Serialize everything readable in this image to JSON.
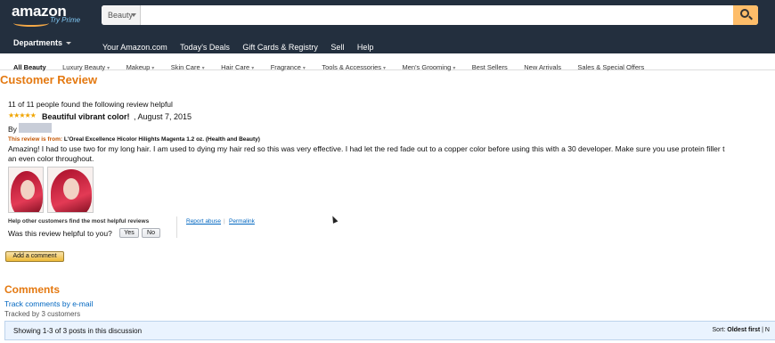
{
  "header": {
    "logo_text": "amazon",
    "logo_sub": "Try Prime",
    "search_category": "Beauty",
    "search_placeholder": ""
  },
  "nav": {
    "departments": "Departments",
    "links": [
      "Your Amazon.com",
      "Today's Deals",
      "Gift Cards & Registry",
      "Sell",
      "Help"
    ]
  },
  "subnav": {
    "items": [
      "All Beauty",
      "Luxury Beauty",
      "Makeup",
      "Skin Care",
      "Hair Care",
      "Fragrance",
      "Tools & Accessories",
      "Men's Grooming",
      "Best Sellers",
      "New Arrivals",
      "Sales & Special Offers"
    ]
  },
  "review": {
    "heading": "Customer Review",
    "helpful_count": "11 of 11 people found the following review helpful",
    "stars": "★★★★★",
    "title": "Beautiful vibrant color!",
    "date": ", August 7, 2015",
    "by": "By",
    "from_label": "This review is from:",
    "product": "L'Oreal Excellence Hicolor Hilights Magenta 1.2 oz. (Health and Beauty)",
    "body_line1": "Amazing! I had to use two for my long hair. I am used to dying my hair red so this was very effective. I had let the red fade out to a copper color before using this with a 30 developer. Make sure you use protein filler t",
    "body_line2": "an even color throughout.",
    "help_caption": "Help other customers find the most helpful reviews",
    "report": "Report abuse",
    "sep": "|",
    "permalink": "Permalink",
    "question": "Was this review helpful to you?",
    "yes": "Yes",
    "no": "No",
    "add_comment": "Add a comment"
  },
  "comments": {
    "heading": "Comments",
    "track": "Track comments by e-mail",
    "tracked": "Tracked by 3 customers",
    "showing": "Showing 1-3 of 3 posts in this discussion",
    "sort_label": "Sort:",
    "sort_value": "Oldest first",
    "sort_more": "| N"
  },
  "colors": {
    "nav_bg": "#232f3e",
    "accent_orange": "#e47911",
    "link_blue": "#0066c0",
    "search_button": "#febd69"
  }
}
